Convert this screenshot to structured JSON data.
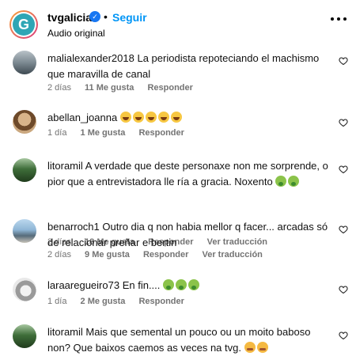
{
  "header": {
    "account": "tvgalicia",
    "avatar_letter": "G",
    "separator": "•",
    "follow_label": "Seguir",
    "subtitle": "Audio original"
  },
  "comments": [
    {
      "user": "malialexander2018",
      "text": "La periodista repoteciando el machismo que maravilla de canal",
      "time": "2 días",
      "likes": "11 Me gusta",
      "reply": "Responder"
    },
    {
      "user": "abellan_joanna",
      "text": "",
      "emojis": [
        "laugh",
        "laugh",
        "laugh",
        "laugh",
        "laugh"
      ],
      "time": "1 día",
      "likes": "1 Me gusta",
      "reply": "Responder"
    },
    {
      "user": "litoramil",
      "text": "A verdade que deste personaxe non me sorprende, o pior que a entrevistadora lle ría a gracia. Noxento",
      "emojis": [
        "vomit",
        "vomit"
      ],
      "time": "2 días",
      "likes": "18 Me gusta",
      "reply": "Responder",
      "translate": "Ver traducción"
    },
    {
      "user": "benarroch1",
      "text": "Outro dia q non habia mellor q facer... arcadas só de relacionar preñar e bertin",
      "time": "2 días",
      "likes": "9 Me gusta",
      "reply": "Responder",
      "translate": "Ver traducción"
    },
    {
      "user": "laraaregueiro73",
      "text": "En fin....",
      "emojis": [
        "vomit",
        "vomit",
        "vomit"
      ],
      "time": "1 día",
      "likes": "2 Me gusta",
      "reply": "Responder"
    },
    {
      "user": "litoramil",
      "text": "Mais que semental un pouco ou un moito baboso non? Que baixos caemos as veces na tvg.",
      "emojis": [
        "angry",
        "angry"
      ],
      "time": "",
      "likes": "",
      "reply": ""
    }
  ],
  "colors": {
    "follow": "#0095f6",
    "meta": "#737373",
    "verified": "#1877f2"
  }
}
